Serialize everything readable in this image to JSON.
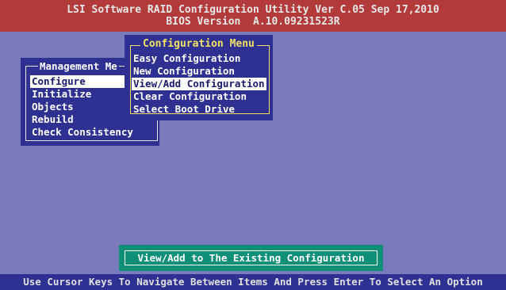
{
  "header": {
    "line1": "LSI Software RAID Configuration Utility Ver C.05 Sep 17,2010",
    "line2": "BIOS Version  A.10.09231523R"
  },
  "management_menu": {
    "title": "Management Me",
    "items": [
      {
        "label": "Configure",
        "selected": true
      },
      {
        "label": "Initialize",
        "selected": false
      },
      {
        "label": "Objects",
        "selected": false
      },
      {
        "label": "Rebuild",
        "selected": false
      },
      {
        "label": "Check Consistency",
        "selected": false
      }
    ]
  },
  "configuration_menu": {
    "title": "Configuration Menu",
    "items": [
      {
        "label": "Easy Configuration",
        "selected": false
      },
      {
        "label": "New Configuration",
        "selected": false
      },
      {
        "label": "View/Add Configuration",
        "selected": true
      },
      {
        "label": "Clear Configuration",
        "selected": false
      },
      {
        "label": "Select Boot Drive",
        "selected": false
      }
    ]
  },
  "status": {
    "description": "View/Add to The Existing Configuration"
  },
  "footer": {
    "hint": "Use Cursor Keys To Navigate Between Items And Press Enter To Select An Option"
  },
  "colors": {
    "background": "#7a7bbd",
    "title_bar": "#b23a3a",
    "window": "#2e3192",
    "accent_yellow": "#f0e066",
    "status_box": "#0f8f78"
  }
}
